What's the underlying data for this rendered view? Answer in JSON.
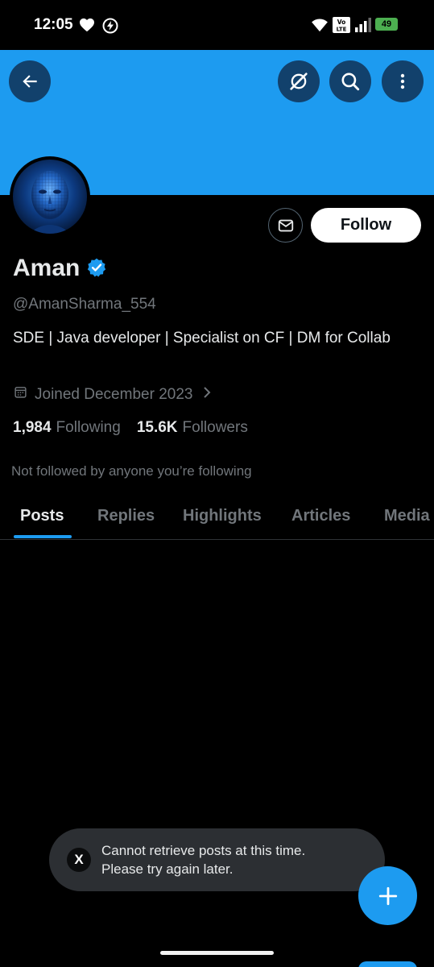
{
  "status_bar": {
    "time": "12:05",
    "battery_level": "49",
    "network_label": "Vo LTE"
  },
  "header": {
    "icons": [
      "back-arrow-icon",
      "grok-icon",
      "search-icon",
      "more-vertical-icon"
    ]
  },
  "profile": {
    "display_name": "Aman",
    "handle": "@AmanSharma_554",
    "bio": "SDE | Java  developer | Specialist on CF | DM for Collab",
    "joined": "Joined December 2023",
    "following_count": "1,984",
    "following_label": "Following",
    "followers_count": "15.6K",
    "followers_label": "Followers",
    "not_followed_text": "Not followed by anyone you’re following",
    "follow_label": "Follow"
  },
  "tabs": [
    {
      "label": "Posts",
      "active": true
    },
    {
      "label": "Replies",
      "active": false
    },
    {
      "label": "Highlights",
      "active": false
    },
    {
      "label": "Articles",
      "active": false
    },
    {
      "label": "Media",
      "active": false
    }
  ],
  "toast": {
    "logo": "X",
    "line1": "Cannot retrieve posts at this time.",
    "line2": "Please try again later."
  },
  "colors": {
    "accent": "#1d9bf0",
    "background": "#000000",
    "secondary_text": "#71767b"
  }
}
